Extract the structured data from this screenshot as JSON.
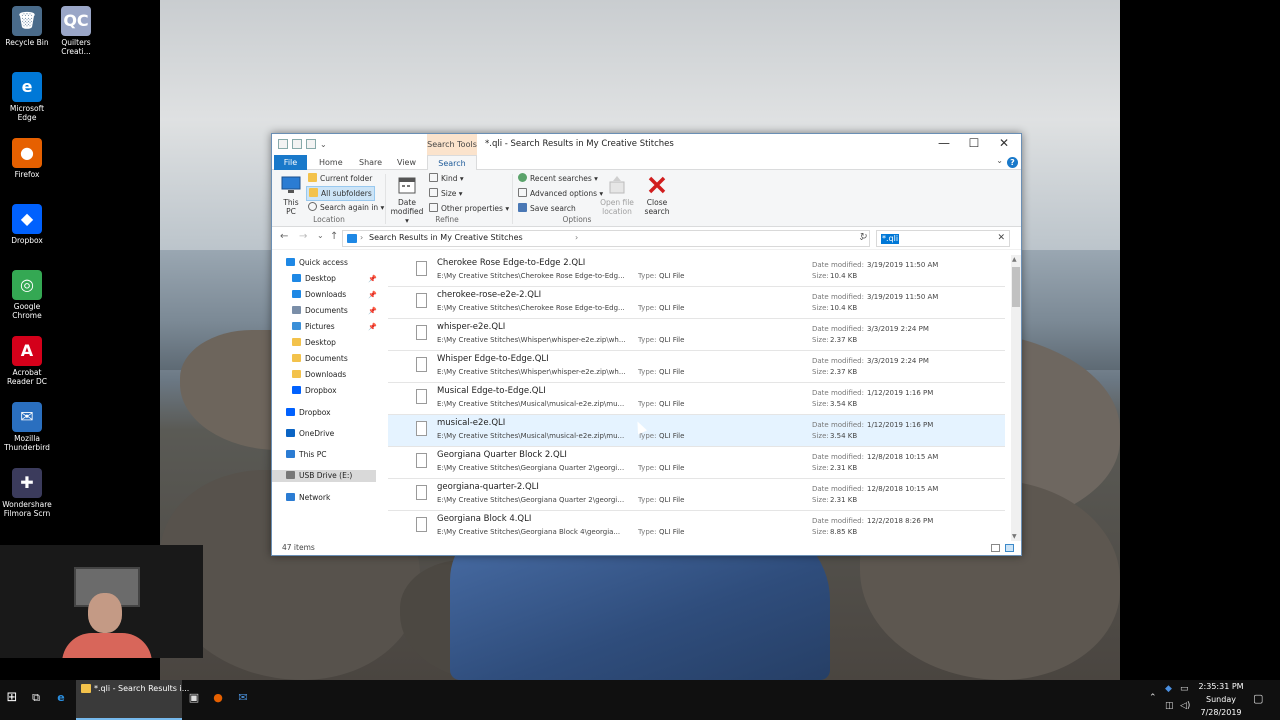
{
  "desktop": {
    "icons": [
      {
        "label": "Recycle Bin",
        "glyph": "🗑",
        "color": "#4a6b8a"
      },
      {
        "label": "Quilters Creati...",
        "glyph": "QC",
        "color": "#9aa6c7"
      },
      {
        "label": "Microsoft Edge",
        "glyph": "e",
        "color": "#0078d7"
      },
      {
        "label": "Firefox",
        "glyph": "●",
        "color": "#e66000"
      },
      {
        "label": "Dropbox",
        "glyph": "◆",
        "color": "#0061fe"
      },
      {
        "label": "Google Chrome",
        "glyph": "◎",
        "color": "#34a853"
      },
      {
        "label": "Acrobat Reader DC",
        "glyph": "A",
        "color": "#d4001a"
      },
      {
        "label": "Mozilla Thunderbird",
        "glyph": "✉",
        "color": "#2a6fbf"
      },
      {
        "label": "Wondershare Filmora Scrn",
        "glyph": "✚",
        "color": "#3b3b5c"
      }
    ]
  },
  "window": {
    "title": "*.qli - Search Results in My Creative Stitches",
    "context_tab": "Search Tools",
    "buttons": {
      "minimize": "—",
      "maximize": "☐",
      "close": "✕"
    },
    "tabs": [
      "File",
      "Home",
      "Share",
      "View",
      "Search"
    ],
    "help": "?",
    "ribbon_collapse": "⌄"
  },
  "ribbon": {
    "location": {
      "label": "Location",
      "this_pc": "This PC",
      "current_folder": "Current folder",
      "all_subfolders": "All subfolders",
      "search_again_in": "Search again in ▾"
    },
    "refine": {
      "label": "Refine",
      "date_modified": "Date modified ▾",
      "kind": "Kind ▾",
      "size": "Size ▾",
      "other_properties": "Other properties ▾"
    },
    "options": {
      "label": "Options",
      "recent_searches": "Recent searches ▾",
      "advanced_options": "Advanced options ▾",
      "save_search": "Save search",
      "open_file_location": "Open file location",
      "close_search": "Close search"
    }
  },
  "address": {
    "back": "←",
    "forward": "→",
    "recent": "⌄",
    "up": "↑",
    "breadcrumb": "Search Results in My Creative Stitches",
    "crumb_arrow": "›",
    "dropdown": "⌄",
    "refresh": "↻",
    "search_query": "*.qli",
    "search_clear": "✕"
  },
  "nav": {
    "items": [
      {
        "label": "Quick access",
        "icon": "star-icon",
        "color": "#1e88e5"
      },
      {
        "label": "Desktop",
        "icon": "desktop-icon",
        "color": "#1e88e5",
        "pinned": true
      },
      {
        "label": "Downloads",
        "icon": "downloads-icon",
        "color": "#1e88e5",
        "pinned": true
      },
      {
        "label": "Documents",
        "icon": "documents-icon",
        "color": "#7a8ea8",
        "pinned": true
      },
      {
        "label": "Pictures",
        "icon": "pictures-icon",
        "color": "#3a8fd8",
        "pinned": true
      },
      {
        "label": "Desktop",
        "icon": "folder-icon",
        "color": "#f3c24b"
      },
      {
        "label": "Documents",
        "icon": "folder-icon",
        "color": "#f3c24b"
      },
      {
        "label": "Downloads",
        "icon": "folder-icon",
        "color": "#f3c24b"
      },
      {
        "label": "Dropbox",
        "icon": "dropbox-icon",
        "color": "#0061fe"
      },
      {
        "label": "Dropbox",
        "icon": "dropbox-icon",
        "color": "#0061fe"
      },
      {
        "label": "OneDrive",
        "icon": "onedrive-icon",
        "color": "#0a64c4"
      },
      {
        "label": "This PC",
        "icon": "this-pc-icon",
        "color": "#2b7cd3"
      },
      {
        "label": "USB Drive (E:)",
        "icon": "usb-drive-icon",
        "color": "#777777"
      },
      {
        "label": "Network",
        "icon": "network-icon",
        "color": "#2b7cd3"
      }
    ],
    "pin_glyph": "📌"
  },
  "files": {
    "type_label": "Type:",
    "date_label": "Date modified:",
    "size_label": "Size:",
    "rows": [
      {
        "name": "Cherokee Rose Edge-to-Edge 2.QLI",
        "path": "E:\\My Creative Stitches\\Cherokee Rose Edge-to-Edg...",
        "type": "QLI File",
        "date": "3/19/2019 11:50 AM",
        "size": "10.4 KB"
      },
      {
        "name": "cherokee-rose-e2e-2.QLI",
        "path": "E:\\My Creative Stitches\\Cherokee Rose Edge-to-Edg...",
        "type": "QLI File",
        "date": "3/19/2019 11:50 AM",
        "size": "10.4 KB"
      },
      {
        "name": "whisper-e2e.QLI",
        "path": "E:\\My Creative Stitches\\Whisper\\whisper-e2e.zip\\wh...",
        "type": "QLI File",
        "date": "3/3/2019 2:24 PM",
        "size": "2.37 KB"
      },
      {
        "name": "Whisper Edge-to-Edge.QLI",
        "path": "E:\\My Creative Stitches\\Whisper\\whisper-e2e.zip\\wh...",
        "type": "QLI File",
        "date": "3/3/2019 2:24 PM",
        "size": "2.37 KB"
      },
      {
        "name": "Musical Edge-to-Edge.QLI",
        "path": "E:\\My Creative Stitches\\Musical\\musical-e2e.zip\\mu...",
        "type": "QLI File",
        "date": "1/12/2019 1:16 PM",
        "size": "3.54 KB"
      },
      {
        "name": "musical-e2e.QLI",
        "path": "E:\\My Creative Stitches\\Musical\\musical-e2e.zip\\mu...",
        "type": "QLI File",
        "date": "1/12/2019 1:16 PM",
        "size": "3.54 KB"
      },
      {
        "name": "Georgiana Quarter Block 2.QLI",
        "path": "E:\\My Creative Stitches\\Georgiana Quarter 2\\georgia...",
        "type": "QLI File",
        "date": "12/8/2018 10:15 AM",
        "size": "2.31 KB"
      },
      {
        "name": "georgiana-quarter-2.QLI",
        "path": "E:\\My Creative Stitches\\Georgiana Quarter 2\\georgia...",
        "type": "QLI File",
        "date": "12/8/2018 10:15 AM",
        "size": "2.31 KB"
      },
      {
        "name": "Georgiana Block 4.QLI",
        "path": "E:\\My Creative Stitches\\Georgiana Block 4\\georgia...",
        "type": "QLI File",
        "date": "12/2/2018 8:26 PM",
        "size": "8.85 KB"
      }
    ]
  },
  "status": {
    "count": "47 items"
  },
  "taskbar": {
    "start": "⊞",
    "task_view": "⧉",
    "explorer_label": "*.qli - Search Results i...",
    "time": "2:35:31 PM",
    "day": "Sunday",
    "date": "7/28/2019"
  }
}
